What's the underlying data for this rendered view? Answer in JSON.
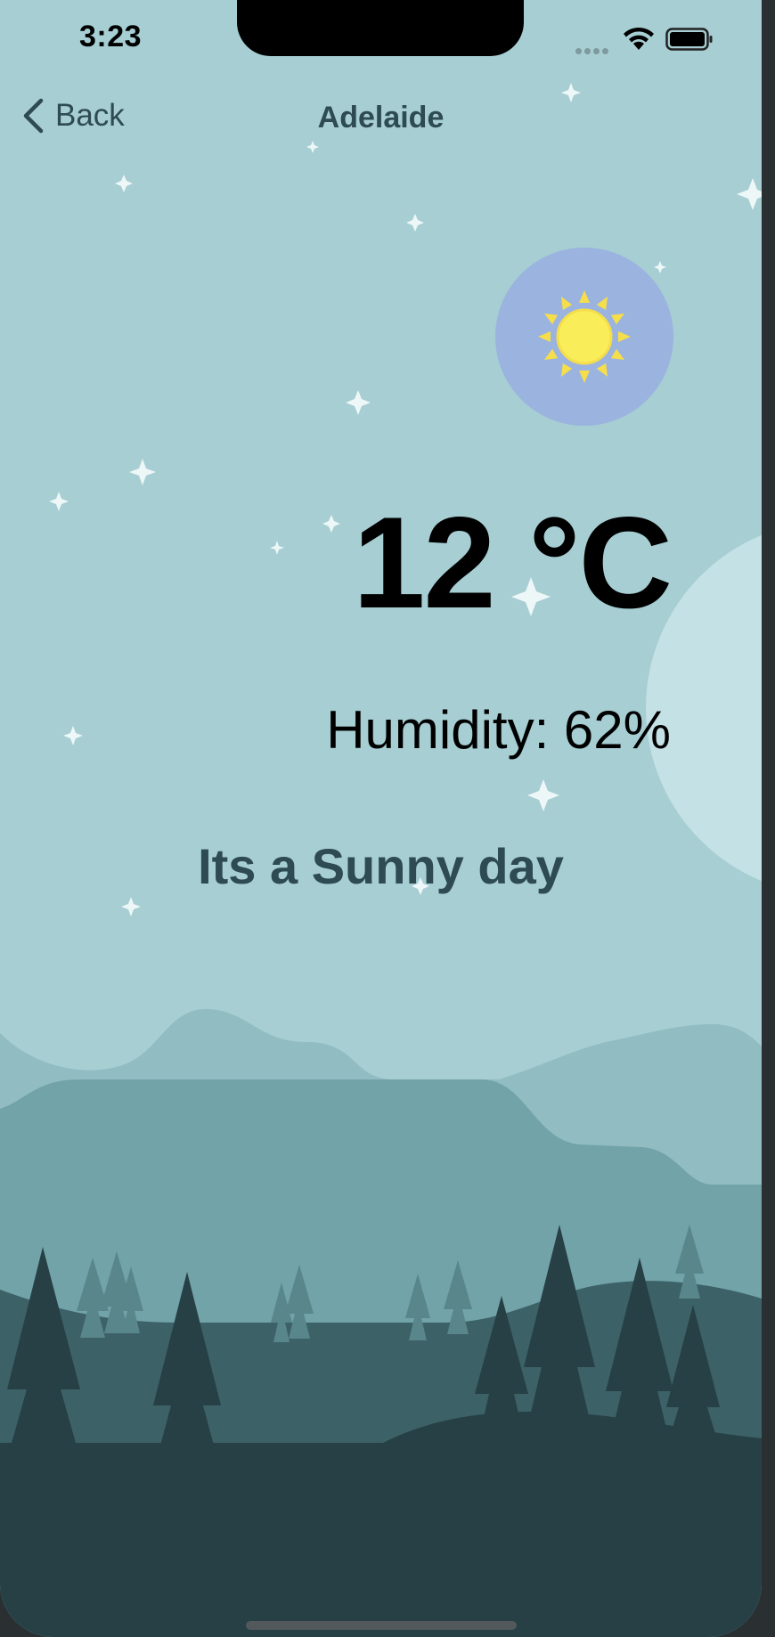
{
  "status_bar": {
    "time": "3:23"
  },
  "nav": {
    "back_label": "Back",
    "title": "Adelaide"
  },
  "weather": {
    "temperature": "12 °C",
    "humidity": "Humidity: 62%",
    "condition": "Its a Sunny day",
    "icon": "sun-icon"
  },
  "colors": {
    "sky": "#a6ced3",
    "sun_badge": "#9bb3df",
    "sun": "#f7e55a",
    "moon": "#c4e1e5",
    "hill_back": "#91bcc2",
    "hill_mid": "#71a3a8",
    "hill_front": "#3c6167",
    "ground": "#264045",
    "text_primary": "#000000",
    "text_secondary": "#2e4a52"
  }
}
